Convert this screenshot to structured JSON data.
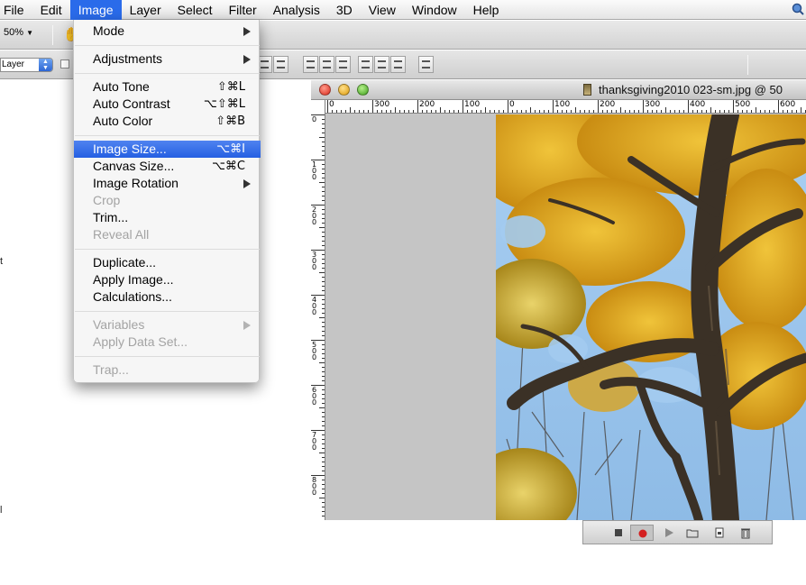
{
  "menubar": {
    "items": [
      "File",
      "Edit",
      "Image",
      "Layer",
      "Select",
      "Filter",
      "Analysis",
      "3D",
      "View",
      "Window",
      "Help"
    ],
    "active": "Image"
  },
  "options_bar": {
    "zoom": "50%",
    "auto_select_value": "Layer"
  },
  "image_menu": {
    "mode": "Mode",
    "adjustments": "Adjustments",
    "auto_tone": {
      "label": "Auto Tone",
      "shortcut": "⇧⌘L"
    },
    "auto_contrast": {
      "label": "Auto Contrast",
      "shortcut": "⌥⇧⌘L"
    },
    "auto_color": {
      "label": "Auto Color",
      "shortcut": "⇧⌘B"
    },
    "image_size": {
      "label": "Image Size...",
      "shortcut": "⌥⌘I"
    },
    "canvas_size": {
      "label": "Canvas Size...",
      "shortcut": "⌥⌘C"
    },
    "image_rotation": "Image Rotation",
    "crop": "Crop",
    "trim": "Trim...",
    "reveal_all": "Reveal All",
    "duplicate": "Duplicate...",
    "apply_image": "Apply Image...",
    "calculations": "Calculations...",
    "variables": "Variables",
    "apply_data_set": "Apply Data Set...",
    "trap": "Trap..."
  },
  "document": {
    "title": "thanksgiving2010 023-sm.jpg @ 50",
    "ruler_h": [
      "0",
      "300",
      "200",
      "100",
      "0",
      "100",
      "200",
      "300",
      "400",
      "500",
      "600"
    ],
    "ruler_v": [
      "0",
      "100",
      "200",
      "300",
      "400",
      "500",
      "600",
      "700",
      "800"
    ]
  },
  "colors": {
    "menu_highlight": "#2a6bea",
    "sky": "#9cc6ee",
    "foliage": "#d9a21c",
    "bark": "#3b3126"
  },
  "stray_text": {
    "left_artifact": "t",
    "left_artifact2": "l"
  }
}
